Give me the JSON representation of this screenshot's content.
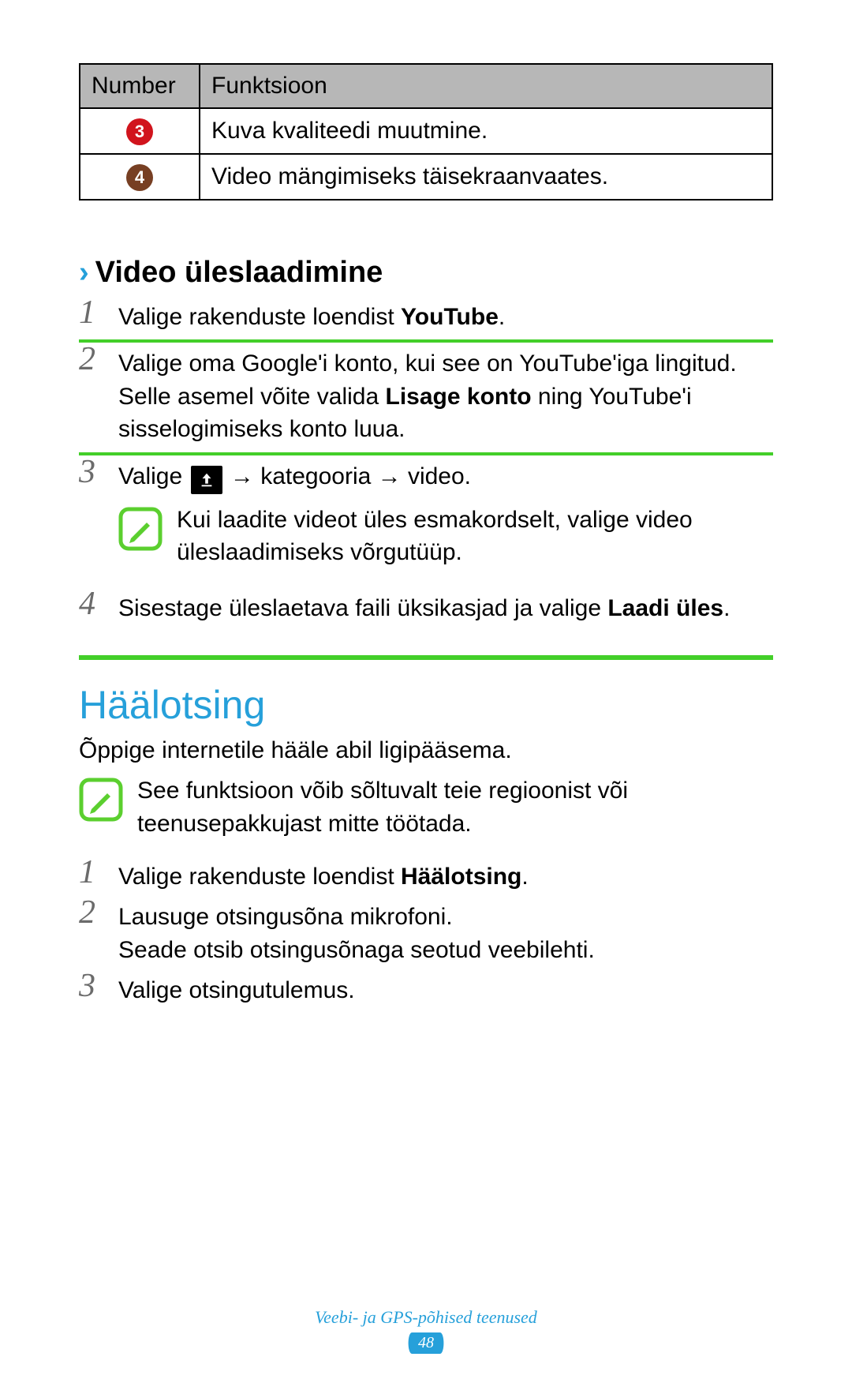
{
  "table": {
    "headers": {
      "number": "Number",
      "function": "Funktsioon"
    },
    "rows": [
      {
        "num": "3",
        "badgeClass": "circ-red",
        "func": "Kuva kvaliteedi muutmine."
      },
      {
        "num": "4",
        "badgeClass": "circ-brown",
        "func": "Video mängimiseks täisekraanvaates."
      }
    ]
  },
  "upload_section": {
    "chevron": "›",
    "title": "Video üleslaadimine",
    "steps": {
      "s1_pre": "Valige rakenduste loendist ",
      "s1_bold": "YouTube",
      "s1_post": ".",
      "s2_line1_pre": "Valige oma Google'i konto, kui see on YouTube'iga lingitud.",
      "s2_line2_pre": "Selle asemel võite valida ",
      "s2_line2_bold": "Lisage konto",
      "s2_line2_post": " ning YouTube'i sisselogimiseks konto luua.",
      "s3_pre": "Valige ",
      "s3_arrow1": " → kategooria → video.",
      "note": "Kui laadite videot üles esmakordselt, valige video üleslaadimiseks võrgutüüp.",
      "s4_pre": "Sisestage üleslaetava faili üksikasjad ja valige ",
      "s4_bold": "Laadi üles",
      "s4_post": "."
    }
  },
  "voice_section": {
    "title": "Häälotsing",
    "intro": "Õppige internetile hääle abil ligipääsema.",
    "note": "See funktsioon võib sõltuvalt teie regioonist või teenusepakkujast mitte töötada.",
    "steps": {
      "s1_pre": "Valige rakenduste loendist ",
      "s1_bold": "Häälotsing",
      "s1_post": ".",
      "s2_line1": "Lausuge otsingusõna mikrofoni.",
      "s2_line2": "Seade otsib otsingusõnaga seotud veebilehti.",
      "s3": "Valige otsingutulemus."
    }
  },
  "footer": {
    "text": "Veebi- ja GPS-põhised teenused",
    "page": "48"
  },
  "nums": {
    "n1": "1",
    "n2": "2",
    "n3": "3",
    "n4": "4"
  }
}
